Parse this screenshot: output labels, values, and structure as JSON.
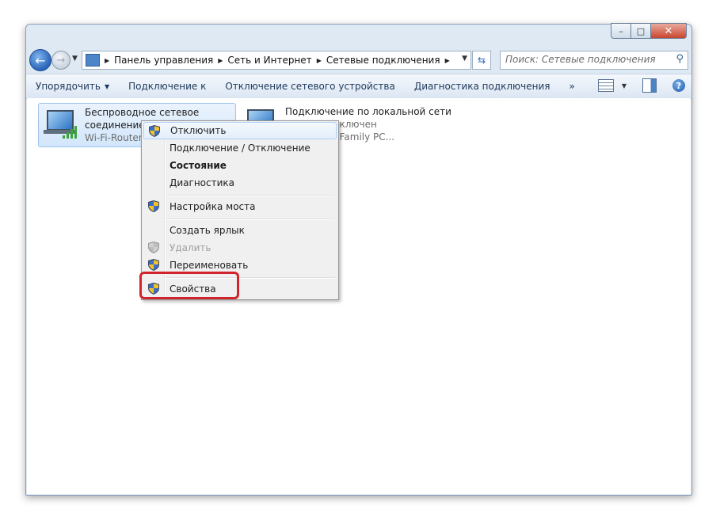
{
  "window": {
    "caption": {
      "minimize": "–",
      "maximize": "□",
      "close": "✕"
    }
  },
  "nav": {
    "back_icon": "back-arrow-icon",
    "forward_icon": "forward-arrow-icon",
    "breadcrumb": [
      "Панель управления",
      "Сеть и Интернет",
      "Сетевые подключения"
    ],
    "search_placeholder": "Поиск: Сетевые подключения"
  },
  "toolbar": {
    "commands": [
      "Упорядочить",
      "Подключение к",
      "Отключение сетевого устройства",
      "Диагностика подключения",
      "»"
    ]
  },
  "connections": [
    {
      "name_line1": "Беспроводное сетевое",
      "name_line2": "соединение",
      "sub": "Wi-Fi-Router_"
    },
    {
      "name_line1": "Подключение по локальной сети",
      "name_line2": "ель не подключен",
      "sub": "n 88E8040 Family PC..."
    }
  ],
  "context_menu": {
    "items": [
      {
        "label": "Отключить",
        "shield": true
      },
      {
        "label": "Подключение / Отключение",
        "shield": false
      },
      {
        "label": "Состояние",
        "shield": false,
        "bold": true
      },
      {
        "label": "Диагностика",
        "shield": false
      },
      {
        "label": "Настройка моста",
        "shield": true
      },
      {
        "label": "Создать ярлык",
        "shield": false
      },
      {
        "label": "Удалить",
        "shield": true,
        "disabled": true
      },
      {
        "label": "Переименовать",
        "shield": true
      },
      {
        "label": "Свойства",
        "shield": true
      }
    ]
  },
  "colors": {
    "highlight": "#d2242d",
    "accent": "#2b69b6",
    "signal": "#3ca33c"
  }
}
